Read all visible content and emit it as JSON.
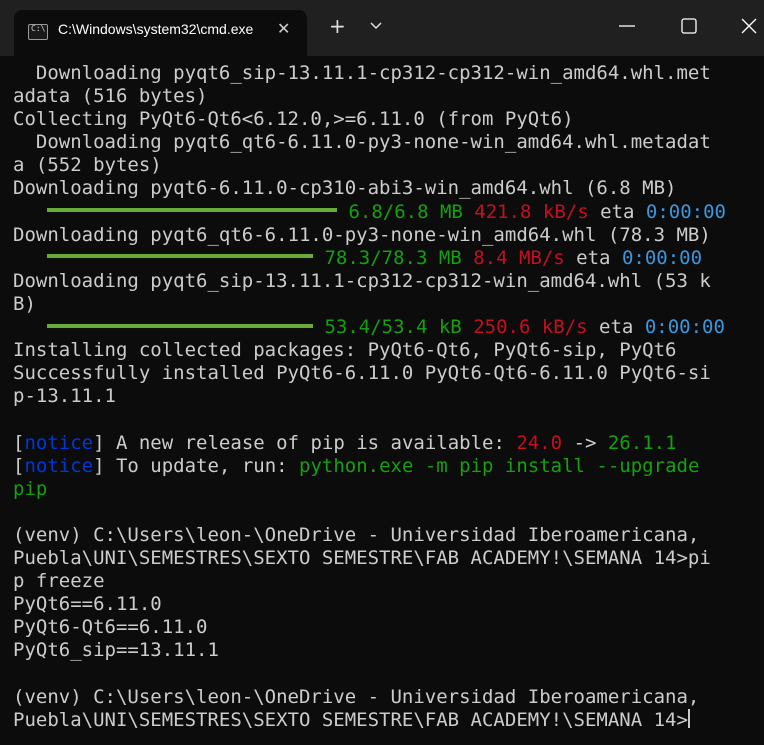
{
  "window": {
    "tab_title": "C:\\Windows\\system32\\cmd.exe",
    "tab_close": "✕",
    "new_tab": "+"
  },
  "colors": {
    "background": "#0c0c0c",
    "titlebar": "#202020",
    "text": "#cccccc",
    "green": "#13a10e",
    "red": "#c50f1f",
    "blue": "#3a96dd",
    "notice": "#0037da",
    "progress_bar": "#6aaa38"
  },
  "terminal": {
    "l1": "  Downloading pyqt6_sip-13.11.1-cp312-cp312-win_amd64.whl.met",
    "l2": "adata (516 bytes)",
    "l3": "Collecting PyQt6-Qt6<6.12.0,>=6.11.0 (from PyQt6)",
    "l4": "  Downloading pyqt6_qt6-6.11.0-py3-none-win_amd64.whl.metadat",
    "l5": "a (552 bytes)",
    "l6": "Downloading pyqt6-6.11.0-cp310-abi3-win_amd64.whl (6.8 MB)",
    "p1": {
      "size": "6.8/6.8 MB",
      "speed": "421.8 kB/s",
      "eta_label": "eta",
      "eta": "0:00:00",
      "fraction": 1.0
    },
    "l8": "Downloading pyqt6_qt6-6.11.0-py3-none-win_amd64.whl (78.3 MB)",
    "p2": {
      "size": "78.3/78.3 MB",
      "speed": "8.4 MB/s",
      "eta_label": "eta",
      "eta": "0:00:00",
      "fraction": 1.0
    },
    "l10": "Downloading pyqt6_sip-13.11.1-cp312-cp312-win_amd64.whl (53 k",
    "l11": "B)",
    "p3": {
      "size": "53.4/53.4 kB",
      "speed": "250.6 kB/s",
      "eta_label": "eta",
      "eta": "0:00:00",
      "fraction": 1.0
    },
    "l13": "Installing collected packages: PyQt6-Qt6, PyQt6-sip, PyQt6",
    "l14": "Successfully installed PyQt6-6.11.0 PyQt6-Qt6-6.11.0 PyQt6-si",
    "l15": "p-13.11.1",
    "n1": {
      "tag": "notice",
      "text": " A new release of pip is available: ",
      "old": "24.0",
      "arrow": " -> ",
      "new": "26.1.1"
    },
    "n2": {
      "tag": "notice",
      "text": " To update, run: ",
      "cmd": "python.exe -m pip install --upgrade"
    },
    "l19": "pip",
    "l21": "(venv) C:\\Users\\leon-\\OneDrive - Universidad Iberoamericana,",
    "l22": "Puebla\\UNI\\SEMESTRES\\SEXTO SEMESTRE\\FAB ACADEMY!\\SEMANA 14>pi",
    "l23": "p freeze",
    "l24": "PyQt6==6.11.0",
    "l25": "PyQt6-Qt6==6.11.0",
    "l26": "PyQt6_sip==13.11.1",
    "l28": "(venv) C:\\Users\\leon-\\OneDrive - Universidad Iberoamericana,",
    "l29": "Puebla\\UNI\\SEMESTRES\\SEXTO SEMESTRE\\FAB ACADEMY!\\SEMANA 14>"
  }
}
